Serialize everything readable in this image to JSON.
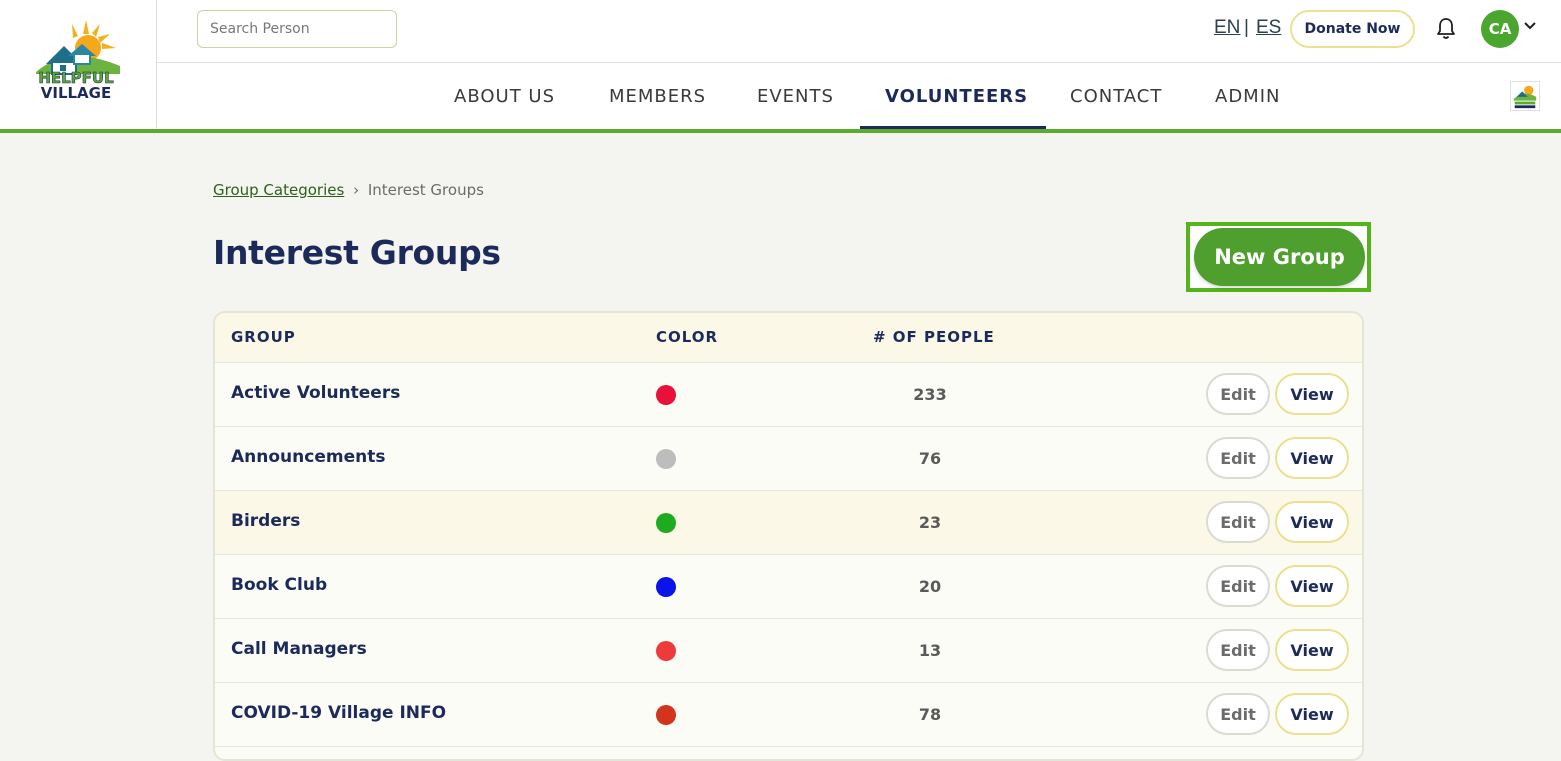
{
  "header": {
    "logo": {
      "line1": "HELPFUL",
      "line2": "VILLAGE"
    },
    "search": {
      "placeholder": "Search Person",
      "value": ""
    },
    "languages": {
      "en": "EN",
      "separator": "|",
      "es": "ES"
    },
    "donate_label": "Donate Now",
    "avatar_initials": "CA",
    "nav": [
      {
        "label": "ABOUT US"
      },
      {
        "label": "MEMBERS"
      },
      {
        "label": "EVENTS"
      },
      {
        "label": "VOLUNTEERS",
        "active": true
      },
      {
        "label": "CONTACT"
      },
      {
        "label": "ADMIN"
      }
    ],
    "colors": {
      "accent_green": "#5aab2e",
      "navy": "#1c2a5a"
    }
  },
  "breadcrumb": {
    "parent": "Group Categories",
    "separator": "›",
    "current": "Interest Groups"
  },
  "page": {
    "title": "Interest Groups",
    "new_group_label": "New Group"
  },
  "table": {
    "headers": {
      "group": "GROUP",
      "color": "COLOR",
      "people": "# OF PEOPLE"
    },
    "edit_label": "Edit",
    "view_label": "View",
    "rows": [
      {
        "name": "Active Volunteers",
        "color": "#e8113a",
        "count": "233"
      },
      {
        "name": "Announcements",
        "color": "#bdbdbd",
        "count": "76"
      },
      {
        "name": "Birders",
        "color": "#1fab1f",
        "count": "23"
      },
      {
        "name": "Book Club",
        "color": "#0a14e8",
        "count": "20"
      },
      {
        "name": "Call Managers",
        "color": "#ee3a3a",
        "count": "13"
      },
      {
        "name": "COVID-19 Village INFO",
        "color": "#d2341c",
        "count": "78"
      }
    ]
  }
}
